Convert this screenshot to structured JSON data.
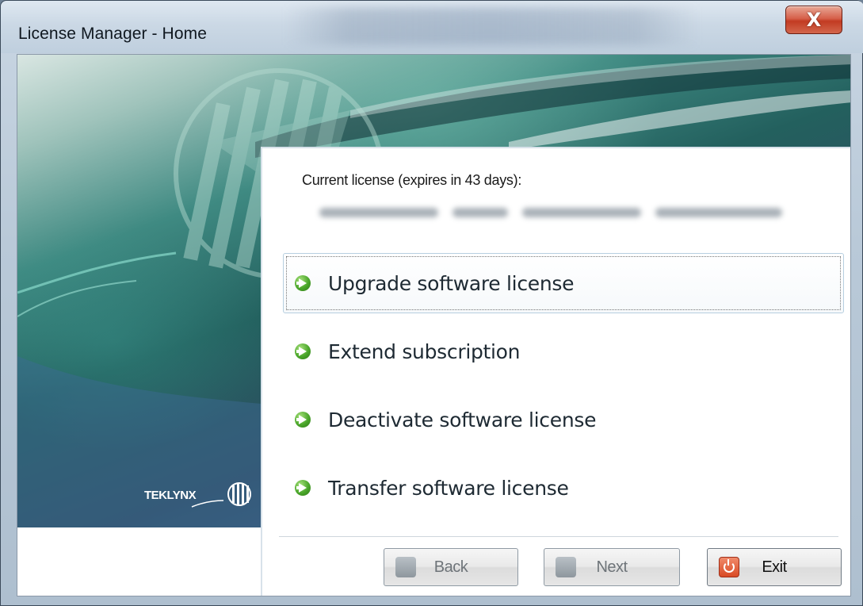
{
  "window": {
    "title": "License Manager - Home",
    "close_glyph": "X"
  },
  "banner": {
    "brand_text": "TEKLYNX"
  },
  "license": {
    "label": "Current license (expires in 43 days):"
  },
  "actions": [
    {
      "label": "Upgrade software license",
      "icon": "green-arrow-icon"
    },
    {
      "label": "Extend subscription",
      "icon": "green-arrow-icon"
    },
    {
      "label": "Deactivate software license",
      "icon": "green-arrow-icon"
    },
    {
      "label": "Transfer software license",
      "icon": "green-arrow-icon"
    }
  ],
  "buttons": {
    "back": "Back",
    "next": "Next",
    "exit": "Exit"
  },
  "colors": {
    "accent_teal": "#23605e",
    "arrow_green": "#4aa62a",
    "exit_red": "#d94a25"
  }
}
